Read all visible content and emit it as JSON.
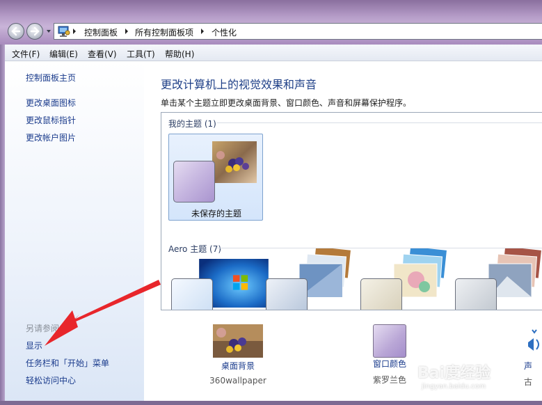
{
  "address": {
    "crumbs": [
      "控制面板",
      "所有控制面板项",
      "个性化"
    ]
  },
  "menu": {
    "items": [
      "文件(F)",
      "编辑(E)",
      "查看(V)",
      "工具(T)",
      "帮助(H)"
    ]
  },
  "left": {
    "home": "控制面板主页",
    "links": [
      "更改桌面图标",
      "更改鼠标指针",
      "更改帐户图片"
    ],
    "see_also": "另请参阅",
    "see_also_links": [
      "显示",
      "任务栏和「开始」菜单",
      "轻松访问中心"
    ]
  },
  "main": {
    "title": "更改计算机上的视觉效果和声音",
    "description": "单击某个主题立即更改桌面背景、窗口颜色、声音和屏幕保护程序。",
    "my_themes_header": "我的主题 (1)",
    "unsaved_theme_label": "未保存的主题",
    "aero_header": "Aero 主题 (7)"
  },
  "settings": {
    "desktop_background": {
      "label": "桌面背景",
      "value": "360wallpaper"
    },
    "window_color": {
      "label": "窗口颜色",
      "value": "紫罗兰色"
    },
    "sound": {
      "label": "声",
      "value": "古"
    }
  },
  "watermark": {
    "logo": "Bai度经验",
    "url": "jingyan.baidu.com"
  },
  "colors": {
    "link": "#1a3b8c",
    "title": "#1e3f87",
    "window_color_swatch": "#b9a6d6",
    "annotation_arrow": "#e8262b"
  },
  "icons": [
    "back-arrow-icon",
    "forward-arrow-icon",
    "control-panel-icon",
    "breadcrumb-chevron-icon",
    "sound-speaker-icon"
  ]
}
